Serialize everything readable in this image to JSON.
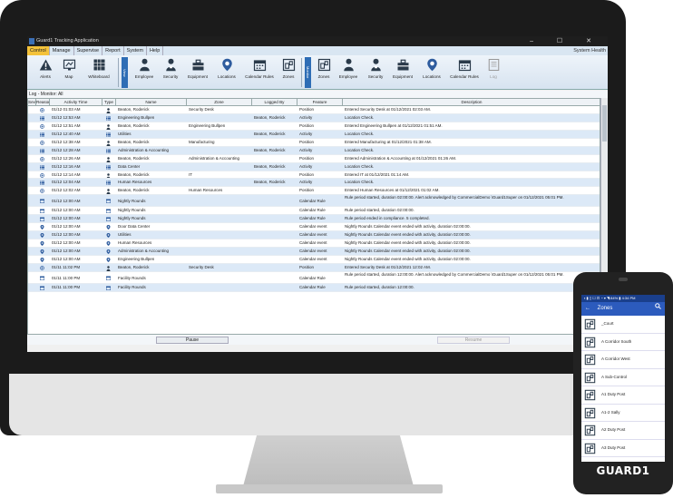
{
  "window": {
    "title": "Guard1 Tracking Application",
    "controls": "–  ☐  ✕"
  },
  "menu": {
    "items": [
      "Control",
      "Manage",
      "Supervise",
      "Report",
      "System",
      "Help"
    ],
    "active_index": 0,
    "system_health": "System Health"
  },
  "ribbon": {
    "left_buttons": [
      "Alerts",
      "Map",
      "Whiteboard"
    ],
    "view_group_tag": "View",
    "view_buttons": [
      "Employee",
      "Security",
      "Equipment",
      "Locations",
      "Calendar Rules",
      "Zones"
    ],
    "monitor_group_tag": "Monitor",
    "monitor_buttons": [
      "Zones",
      "Employee",
      "Security",
      "Equipment",
      "Locations",
      "Calendar Rules",
      "Log"
    ]
  },
  "breadcrumb": "Log - Monitor: All",
  "grid": {
    "columns": [
      "Sev",
      "Reason",
      "Activity Time",
      "Type",
      "Name",
      "Zone",
      "Logged By",
      "Feature",
      "Description"
    ],
    "rows": [
      {
        "type": "position",
        "time": "01/12 01:03 AM",
        "name": "Beaton, Roderick",
        "zone": "Security Desk",
        "logged_by": "",
        "feature": "Position",
        "desc": "Entered Security Desk at 01/12/2021 02:03 AM."
      },
      {
        "type": "activity",
        "time": "01/12 12:53 AM",
        "name": "Engineering Bullpen",
        "zone": "",
        "logged_by": "Beaton, Roderick",
        "feature": "Activity",
        "desc": "Location Check."
      },
      {
        "type": "position",
        "time": "01/12 12:51 AM",
        "name": "Beaton, Roderick",
        "zone": "Engineering Bullpen",
        "logged_by": "",
        "feature": "Position",
        "desc": "Entered Engineering Bullpen at 01/12/2021 01:51 AM."
      },
      {
        "type": "activity",
        "time": "01/12 12:40 AM",
        "name": "Utilities",
        "zone": "",
        "logged_by": "Beaton, Roderick",
        "feature": "Activity",
        "desc": "Location Check."
      },
      {
        "type": "position",
        "time": "01/12 12:38 AM",
        "name": "Beaton, Roderick",
        "zone": "Manufacturing",
        "logged_by": "",
        "feature": "Position",
        "desc": "Entered Manufacturing at 01/12/2021 01:38 AM."
      },
      {
        "type": "activity",
        "time": "01/12 12:28 AM",
        "name": "Administration & Accounting",
        "zone": "",
        "logged_by": "Beaton, Roderick",
        "feature": "Activity",
        "desc": "Location Check."
      },
      {
        "type": "position",
        "time": "01/12 12:26 AM",
        "name": "Beaton, Roderick",
        "zone": "Administration & Accounting",
        "logged_by": "",
        "feature": "Position",
        "desc": "Entered Administration & Accounting at 01/12/2021 01:26 AM."
      },
      {
        "type": "activity",
        "time": "01/12 12:16 AM",
        "name": "Data Center",
        "zone": "",
        "logged_by": "Beaton, Roderick",
        "feature": "Activity",
        "desc": "Location Check."
      },
      {
        "type": "position",
        "time": "01/12 12:14 AM",
        "name": "Beaton, Roderick",
        "zone": "IT",
        "logged_by": "",
        "feature": "Position",
        "desc": "Entered IT at 01/12/2021 01:14 AM."
      },
      {
        "type": "activity",
        "time": "01/12 12:04 AM",
        "name": "Human Resources",
        "zone": "",
        "logged_by": "Beaton, Roderick",
        "feature": "Activity",
        "desc": "Location Check."
      },
      {
        "type": "position",
        "time": "01/12 12:02 AM",
        "name": "Beaton, Roderick",
        "zone": "Human Resources",
        "logged_by": "",
        "feature": "Position",
        "desc": "Entered Human Resources at 01/12/2021 01:02 AM."
      },
      {
        "type": "calendar",
        "time": "01/12 12:00 AM",
        "name": "Nightly Rounds",
        "zone": "",
        "logged_by": "",
        "feature": "Calendar Rule",
        "desc": "Rule period started, duration 02:00:00. Alert acknowledged by CommercialDemo \\Guard1Super on 01/12/2021 05:01 PM.",
        "tall": true
      },
      {
        "type": "calendar",
        "time": "01/12 12:00 AM",
        "name": "Nightly Rounds",
        "zone": "",
        "logged_by": "",
        "feature": "Calendar Rule",
        "desc": "Rule period started, duration 02:00:00."
      },
      {
        "type": "calendar",
        "time": "01/12 12:00 AM",
        "name": "Nightly Rounds",
        "zone": "",
        "logged_by": "",
        "feature": "Calendar Rule",
        "desc": "Rule period ended in compliance. 5 completed."
      },
      {
        "type": "location",
        "time": "01/12 12:00 AM",
        "name": "Door Data Center",
        "zone": "",
        "logged_by": "",
        "feature": "Calendar event",
        "desc": "Nightly Rounds Calendar event ended with activity, duration 02:00:00."
      },
      {
        "type": "location",
        "time": "01/12 12:00 AM",
        "name": "Utilities",
        "zone": "",
        "logged_by": "",
        "feature": "Calendar event",
        "desc": "Nightly Rounds Calendar event ended with activity, duration 02:00:00."
      },
      {
        "type": "location",
        "time": "01/12 12:00 AM",
        "name": "Human Resources",
        "zone": "",
        "logged_by": "",
        "feature": "Calendar event",
        "desc": "Nightly Rounds Calendar event ended with activity, duration 02:00:00."
      },
      {
        "type": "location",
        "time": "01/12 12:00 AM",
        "name": "Administration & Accounting",
        "zone": "",
        "logged_by": "",
        "feature": "Calendar event",
        "desc": "Nightly Rounds Calendar event ended with activity, duration 02:00:00."
      },
      {
        "type": "location",
        "time": "01/12 12:00 AM",
        "name": "Engineering Bullpen",
        "zone": "",
        "logged_by": "",
        "feature": "Calendar event",
        "desc": "Nightly Rounds Calendar event ended with activity, duration 02:00:00."
      },
      {
        "type": "position",
        "time": "01/11 11:02 PM",
        "name": "Beaton, Roderick",
        "zone": "Security Desk",
        "logged_by": "",
        "feature": "Position",
        "desc": "Entered Security Desk at 01/12/2021 12:02 AM."
      },
      {
        "type": "calendar",
        "time": "01/11 11:00 PM",
        "name": "Facility Rounds",
        "zone": "",
        "logged_by": "",
        "feature": "Calendar Rule",
        "desc": "Rule period started, duration 12:00:00. Alert acknowledged by CommercialDemo \\Guard1Super on 01/12/2021 05:01 PM.",
        "tall": true
      },
      {
        "type": "calendar",
        "time": "01/11 11:00 PM",
        "name": "Facility Rounds",
        "zone": "",
        "logged_by": "",
        "feature": "Calendar Rule",
        "desc": "Rule period started, duration 12:00:00."
      }
    ]
  },
  "bottom": {
    "pause": "Pause",
    "resume": "Resume"
  },
  "phone": {
    "status": "▪ ▮ ▯ ☐           ⊡ ◔ ▾ ◥ 84% ▮ 4:34 PM",
    "title": "Zones",
    "back": "←",
    "search": "🔍",
    "items": [
      "_Court",
      "A Corridor South",
      "A Corridor West",
      "A Sub-Control",
      "A1 Duty Post",
      "A1-2 Sally",
      "A2 Duty Post",
      "A3 Duty Post"
    ],
    "brand": "GUARD1"
  },
  "colors": {
    "accent": "#2e6db5",
    "menu_active": "#f4c23a",
    "row_alt": "#dce9f7"
  }
}
